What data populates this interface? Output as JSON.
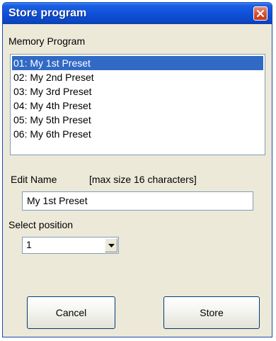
{
  "window": {
    "title": "Store program"
  },
  "memory": {
    "label": "Memory Program",
    "items": [
      "01: My 1st Preset",
      "02: My 2nd Preset",
      "03: My 3rd Preset",
      "04: My 4th Preset",
      "05: My 5th Preset",
      "06: My 6th Preset"
    ],
    "selected_index": 0
  },
  "edit_name": {
    "label": "Edit Name",
    "hint": "[max size 16 characters]",
    "value": "My 1st Preset"
  },
  "position": {
    "label": "Select position",
    "value": "1"
  },
  "buttons": {
    "cancel": "Cancel",
    "store": "Store"
  },
  "colors": {
    "title_bar": "#0f4fd8",
    "selection": "#316ac5",
    "dialog_bg": "#ece9d8"
  }
}
